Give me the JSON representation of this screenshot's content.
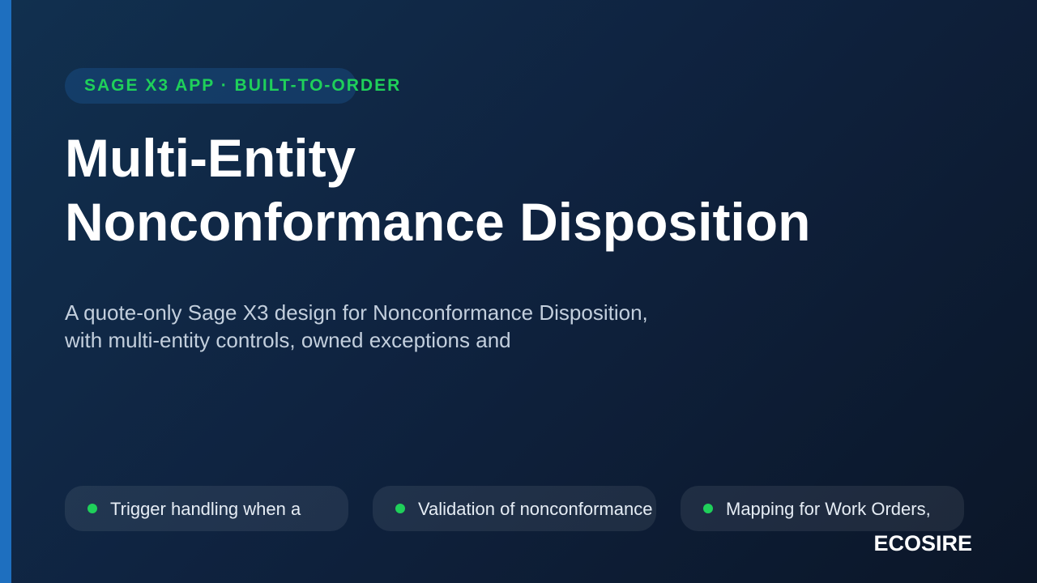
{
  "eyebrow": {
    "label": "SAGE X3 APP · BUILT-TO-ORDER"
  },
  "title": {
    "line1": "Multi-Entity",
    "line2": "Nonconformance Disposition"
  },
  "subtitle": {
    "line1": "A quote-only Sage X3 design for Nonconformance Disposition,",
    "line2": "with multi-entity controls, owned exceptions and"
  },
  "features": [
    {
      "label": "Trigger handling when a"
    },
    {
      "label": "Validation of nonconformance"
    },
    {
      "label": "Mapping for Work Orders,"
    }
  ],
  "brand": {
    "name": "ECOSIRE"
  },
  "colors": {
    "accent": "#1e6fbf",
    "highlight": "#1fd05a",
    "background": "#0f2340"
  }
}
